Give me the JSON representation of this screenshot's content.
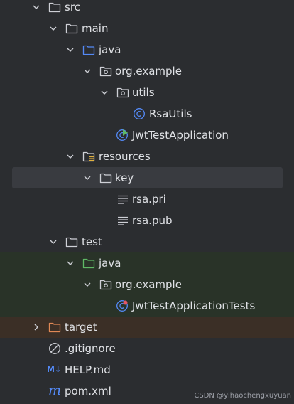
{
  "tree": {
    "src": "src",
    "main": "main",
    "java_main": "java",
    "org_example_main": "org.example",
    "utils": "utils",
    "rsautils": "RsaUtils",
    "jwttestapplication": "JwtTestApplication",
    "resources": "resources",
    "key": "key",
    "rsa_pri": "rsa.pri",
    "rsa_pub": "rsa.pub",
    "test": "test",
    "java_test": "java",
    "org_example_test": "org.example",
    "jwttestapplicationtests": "JwtTestApplicationTests",
    "target": "target",
    "gitignore": ".gitignore",
    "help_md": "HELP.md",
    "pom_xml": "pom.xml"
  },
  "icons": {
    "md_badge": "M↓",
    "maven_badge": "m"
  },
  "watermark": "CSDN @yihaochengxuyuan",
  "colors": {
    "background": "#2b2d30",
    "selected_row": "#393b40",
    "test_tint": "#293328",
    "excluded_tint": "#3b2f26",
    "source_folder": "#548af7",
    "test_folder": "#5fb865",
    "excluded_folder": "#e08855",
    "class_icon": "#548af7"
  }
}
